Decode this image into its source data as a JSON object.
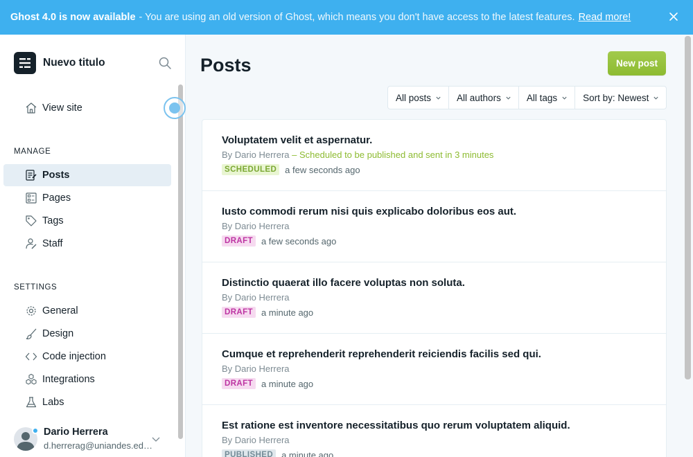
{
  "banner": {
    "headline": "Ghost 4.0 is now available",
    "message": "- You are using an old version of Ghost, which means you don't have access to the latest features.",
    "link": "Read more!",
    "close_icon": "close-icon",
    "color": "#3eb0ef"
  },
  "sidebar": {
    "site_title": "Nuevo titulo",
    "view_site": "View site",
    "manage_title": "MANAGE",
    "manage_items": [
      {
        "label": "Posts",
        "icon": "posts-icon",
        "active": true
      },
      {
        "label": "Pages",
        "icon": "pages-icon"
      },
      {
        "label": "Tags",
        "icon": "tag-icon"
      },
      {
        "label": "Staff",
        "icon": "staff-icon"
      }
    ],
    "settings_title": "SETTINGS",
    "settings_items": [
      {
        "label": "General",
        "icon": "gear-icon"
      },
      {
        "label": "Design",
        "icon": "brush-icon"
      },
      {
        "label": "Code injection",
        "icon": "code-icon"
      },
      {
        "label": "Integrations",
        "icon": "integrations-icon"
      },
      {
        "label": "Labs",
        "icon": "flask-icon"
      }
    ],
    "user": {
      "name": "Dario Herrera",
      "email": "d.herrerag@uniandes.edu.co"
    }
  },
  "main": {
    "title": "Posts",
    "new_post": "New post",
    "filters": [
      "All posts",
      "All authors",
      "All tags",
      "Sort by: Newest"
    ],
    "posts": [
      {
        "title": "Voluptatem velit et aspernatur.",
        "by": "By",
        "author": "Dario Herrera",
        "note": "– Scheduled to be published and sent in 3 minutes",
        "status": "SCHEDULED",
        "time": "a few seconds ago"
      },
      {
        "title": "Iusto commodi rerum nisi quis explicabo doloribus eos aut.",
        "by": "By",
        "author": "Dario Herrera",
        "note": "",
        "status": "DRAFT",
        "time": "a few seconds ago"
      },
      {
        "title": "Distinctio quaerat illo facere voluptas non soluta.",
        "by": "By",
        "author": "Dario Herrera",
        "note": "",
        "status": "DRAFT",
        "time": "a minute ago"
      },
      {
        "title": "Cumque et reprehenderit reprehenderit reiciendis facilis sed qui.",
        "by": "By",
        "author": "Dario Herrera",
        "note": "",
        "status": "DRAFT",
        "time": "a minute ago"
      },
      {
        "title": "Est ratione est inventore necessitatibus quo rerum voluptatem aliquid.",
        "by": "By",
        "author": "Dario Herrera",
        "note": "",
        "status": "PUBLISHED",
        "time": "a minute ago"
      }
    ],
    "accent_color": "#9fca4a"
  }
}
